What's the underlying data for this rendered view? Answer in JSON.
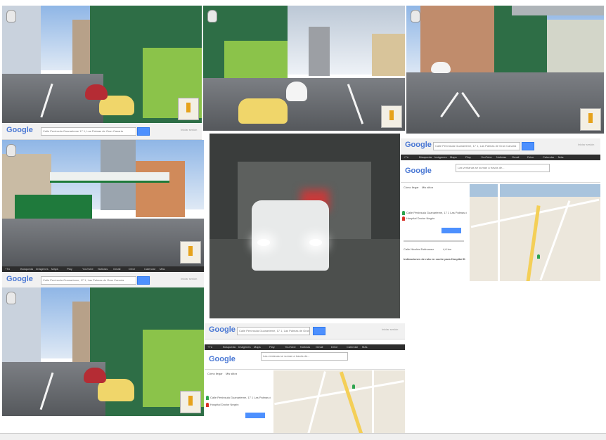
{
  "colors": {
    "google_blue": "#4d90fe",
    "building_green": "#2e6e46",
    "lime_trim": "#8bc34a",
    "map_yellow": "#f4cf57"
  },
  "google_logo": "Google",
  "search_queries": {
    "middle": "Calle Peninsula Guanarteme 17 1, Las Palmas de Gran Canaria",
    "right": "Calle Península Guanarteme, 17 1, Las Palmas de Gran Canaria",
    "bottom": "Calle Península Guanarteme, 17 1, Las Palmas de Gran Canaria"
  },
  "right_link": "Iniciar sesión",
  "nav_items": [
    "+Tú",
    "Búsqueda",
    "Imágenes",
    "Maps",
    "Play",
    "YouTube",
    "Noticias",
    "Gmail",
    "Drive",
    "Calendar",
    "Más"
  ],
  "directions_panel": {
    "tab_get": "Cómo llegar",
    "tab_my": "Mis sitios",
    "origin": "Calle Peninsula Guanarteme, 17 1 Las Palmas d...",
    "destination": "Hospital Doctor Negrín",
    "route_btn": "Cómo llegar",
    "summary_title": "Indicaciones de ruta en coche para Hospital Doctor Negrín",
    "route_label": "Calle Nicolás Estévanez",
    "route_dist": "4,6 km"
  },
  "tooltip": "Las ventanas se suman a travás de..."
}
